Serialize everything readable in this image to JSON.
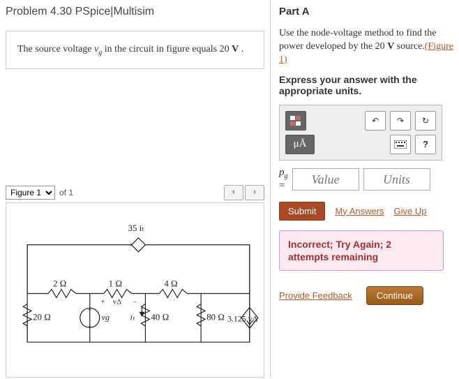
{
  "problem": {
    "title": "Problem 4.30 PSpice|Multisim",
    "stem_pre": "The source voltage ",
    "stem_var": "v",
    "stem_sub": "g",
    "stem_post": " in the circuit in figure equals 20 ",
    "stem_unit": "V",
    "stem_tail": " ."
  },
  "figure": {
    "selected": "Figure 1",
    "of_label": "of 1"
  },
  "circuit": {
    "top_label": "35 iₜ",
    "r1": "2 Ω",
    "r2": "1 Ω",
    "r3": "4 Ω",
    "va": "vΔ",
    "r4": "20 Ω",
    "vg": "vg",
    "it": "iₜ",
    "r5": "40 Ω",
    "r6": "80 Ω",
    "isrc": "3.125 vΔ"
  },
  "partA": {
    "title": "Part A",
    "instr_pre": "Use the node-voltage method to find the power developed by the 20 ",
    "instr_v": "V",
    "instr_post": " source.",
    "figure_link": "(Figure 1)",
    "hint": "Express your answer with the appropriate units.",
    "unit_btn": "μÅ",
    "help": "?",
    "pg_label": "p",
    "pg_sub": "g",
    "value_ph": "Value",
    "units_ph": "Units",
    "submit": "Submit",
    "my_answers": "My Answers",
    "give_up": "Give Up",
    "feedback": "Incorrect; Try Again; 2 attempts remaining",
    "provide_feedback": "Provide Feedback",
    "continue": "Continue"
  }
}
